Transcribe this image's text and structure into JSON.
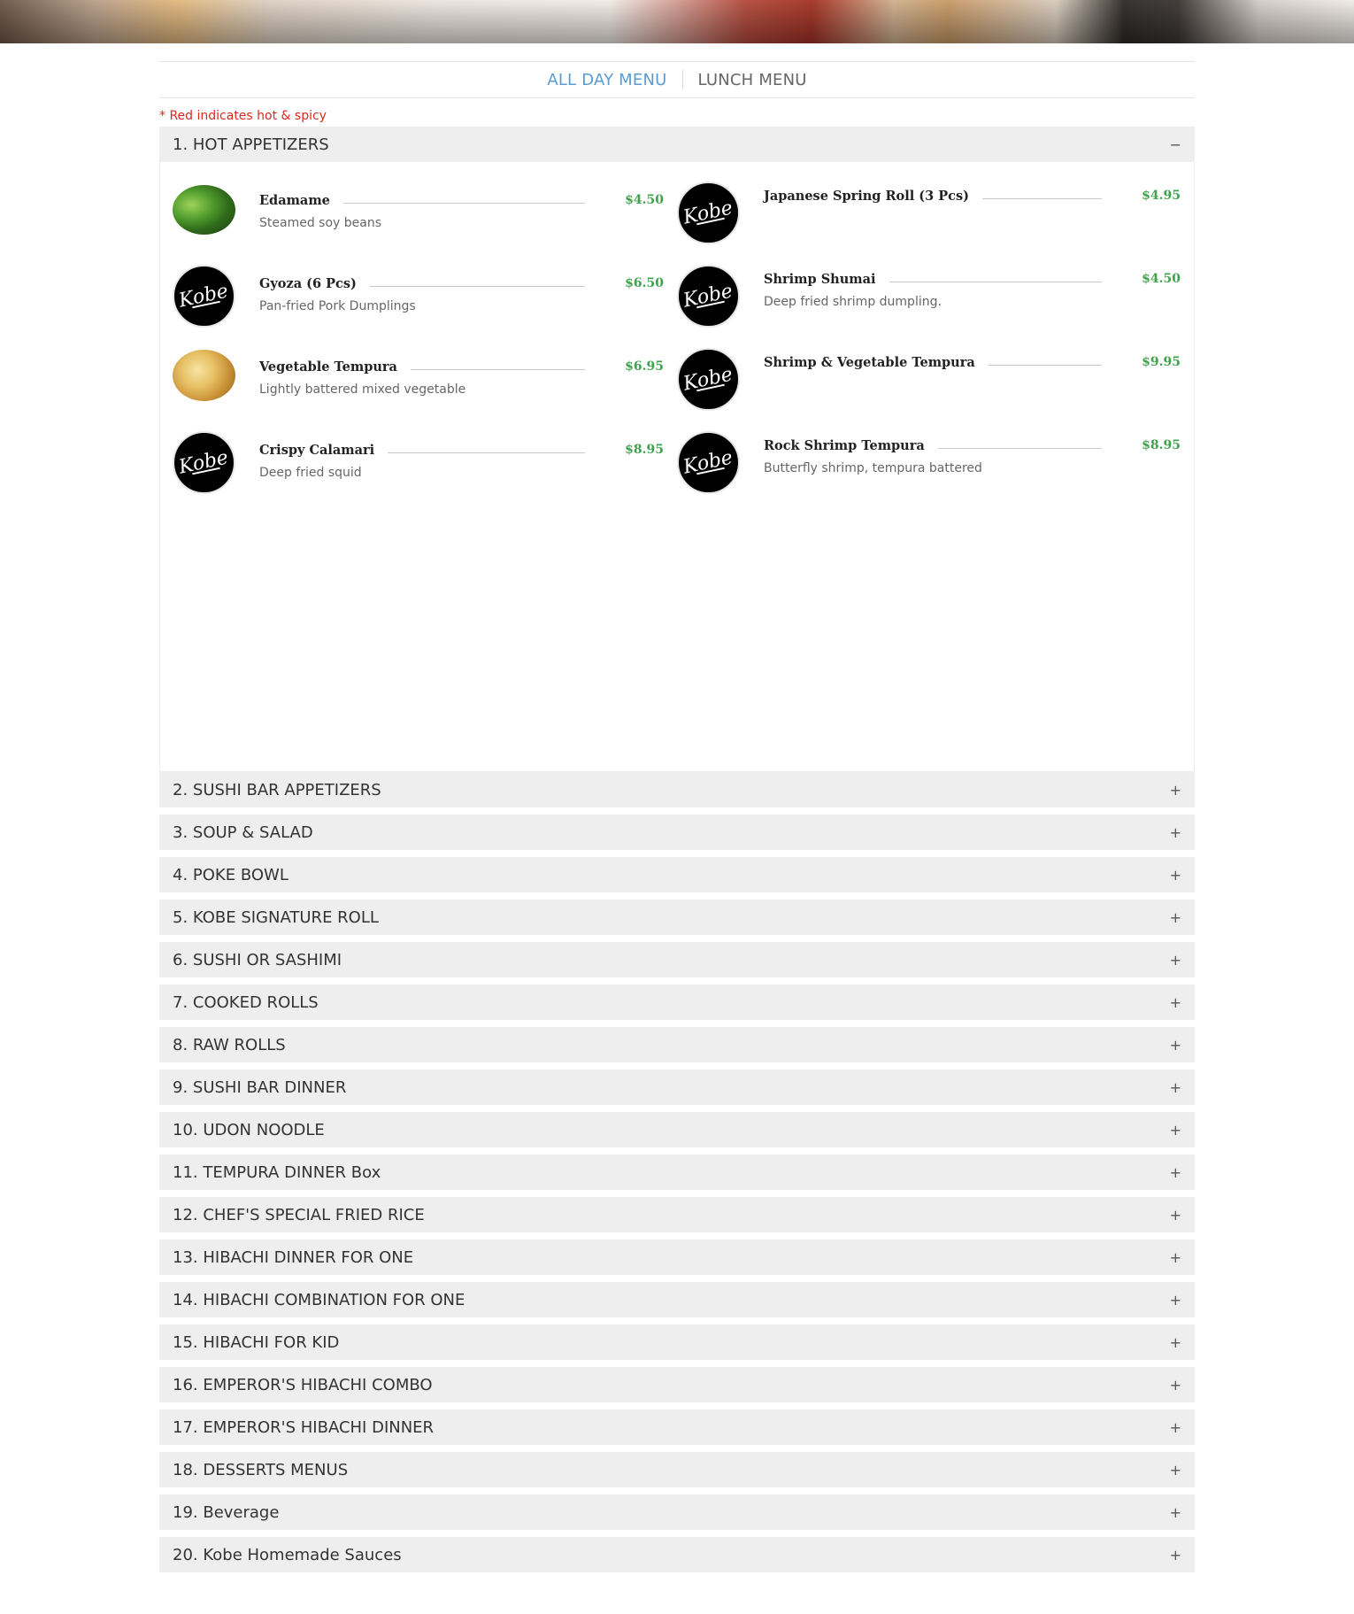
{
  "tabs": [
    {
      "label": "ALL DAY MENU",
      "active": true
    },
    {
      "label": "LUNCH MENU",
      "active": false
    }
  ],
  "note": "* Red indicates hot & spicy",
  "colors": {
    "accent": "#5a9bd4",
    "price": "#3fa34d",
    "spicy": "#d62b1f"
  },
  "open_section": {
    "title": "1. HOT APPETIZERS",
    "toggle": "−",
    "items": [
      {
        "name": "Edamame",
        "price": "$4.50",
        "desc": "Steamed soy beans",
        "image": "edamame-photo"
      },
      {
        "name": "Japanese Spring Roll (3 Pcs)",
        "price": "$4.95",
        "desc": "",
        "image": "kobe-logo"
      },
      {
        "name": "Gyoza (6 Pcs)",
        "price": "$6.50",
        "desc": "Pan-fried Pork Dumplings",
        "image": "kobe-logo"
      },
      {
        "name": "Shrimp Shumai",
        "price": "$4.50",
        "desc": "Deep fried shrimp dumpling.",
        "image": "kobe-logo"
      },
      {
        "name": "Vegetable Tempura",
        "price": "$6.95",
        "desc": "Lightly battered mixed vegetable",
        "image": "tempura-photo"
      },
      {
        "name": "Shrimp & Vegetable Tempura",
        "price": "$9.95",
        "desc": "",
        "image": "kobe-logo"
      },
      {
        "name": "Crispy Calamari",
        "price": "$8.95",
        "desc": "Deep fried squid",
        "image": "kobe-logo"
      },
      {
        "name": "Rock Shrimp Tempura",
        "price": "$8.95",
        "desc": "Butterfly shrimp, tempura battered",
        "image": "kobe-logo"
      }
    ]
  },
  "sections": [
    {
      "title": "2. SUSHI BAR APPETIZERS",
      "toggle": "+"
    },
    {
      "title": "3. SOUP & SALAD",
      "toggle": "+"
    },
    {
      "title": "4. POKE BOWL",
      "toggle": "+"
    },
    {
      "title": "5. KOBE SIGNATURE ROLL",
      "toggle": "+"
    },
    {
      "title": "6. SUSHI OR SASHIMI",
      "toggle": "+"
    },
    {
      "title": "7. COOKED ROLLS",
      "toggle": "+"
    },
    {
      "title": "8. RAW ROLLS",
      "toggle": "+"
    },
    {
      "title": "9. SUSHI BAR DINNER",
      "toggle": "+"
    },
    {
      "title": "10. UDON NOODLE",
      "toggle": "+"
    },
    {
      "title": "11. TEMPURA DINNER Box",
      "toggle": "+"
    },
    {
      "title": "12. CHEF'S SPECIAL FRIED RICE",
      "toggle": "+"
    },
    {
      "title": "13. HIBACHI DINNER FOR ONE",
      "toggle": "+"
    },
    {
      "title": "14. HIBACHI COMBINATION FOR ONE",
      "toggle": "+"
    },
    {
      "title": "15. HIBACHI FOR KID",
      "toggle": "+"
    },
    {
      "title": "16. EMPEROR'S HIBACHI COMBO",
      "toggle": "+"
    },
    {
      "title": "17. EMPEROR'S HIBACHI DINNER",
      "toggle": "+"
    },
    {
      "title": "18. DESSERTS MENUS",
      "toggle": "+"
    },
    {
      "title": "19. Beverage",
      "toggle": "+"
    },
    {
      "title": "20. Kobe Homemade Sauces",
      "toggle": "+"
    }
  ]
}
